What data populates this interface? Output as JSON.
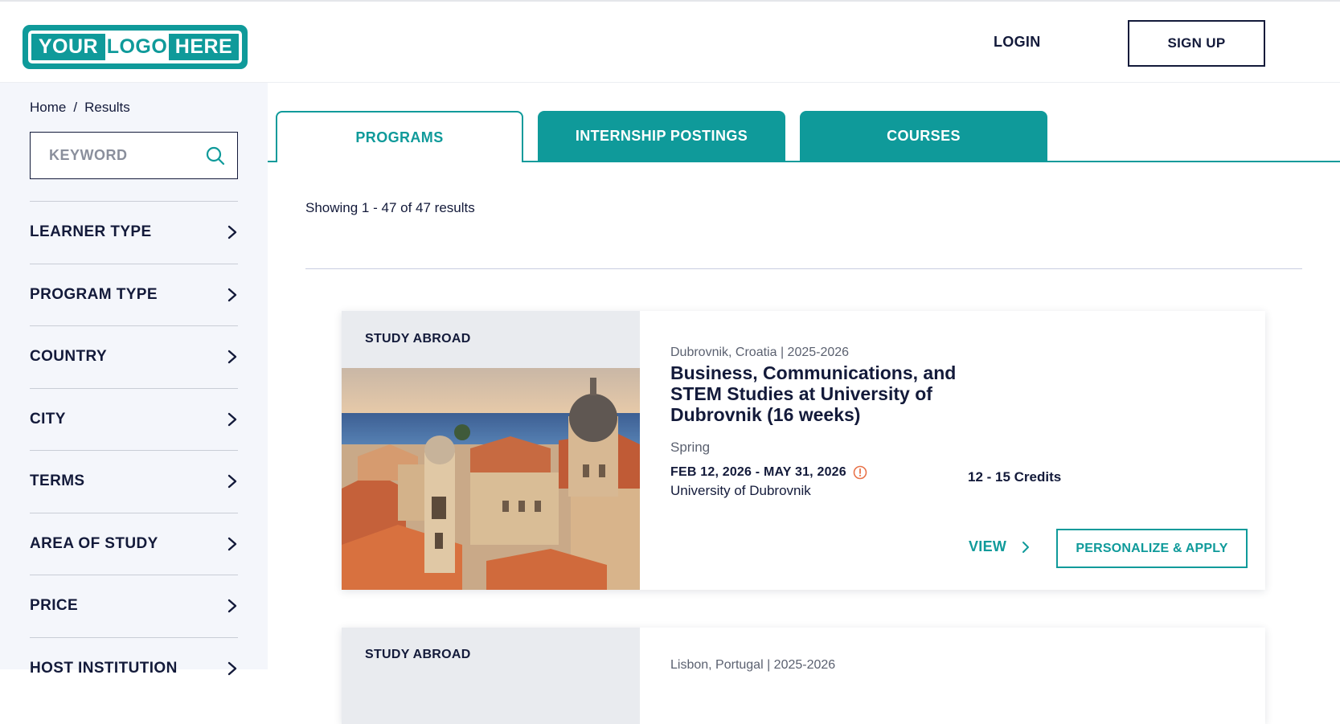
{
  "header": {
    "logo": {
      "seg1": "YOUR",
      "seg2": "LOGO",
      "seg3": "HERE"
    },
    "login_label": "LOGIN",
    "signup_label": "SIGN UP"
  },
  "sidebar": {
    "breadcrumb": {
      "home": "Home",
      "separator": "/",
      "current": "Results"
    },
    "search": {
      "placeholder": "KEYWORD",
      "value": ""
    },
    "filters": [
      {
        "label": "LEARNER TYPE"
      },
      {
        "label": "PROGRAM TYPE"
      },
      {
        "label": "COUNTRY"
      },
      {
        "label": "CITY"
      },
      {
        "label": "TERMS"
      },
      {
        "label": "AREA OF STUDY"
      },
      {
        "label": "PRICE"
      },
      {
        "label": "HOST INSTITUTION"
      }
    ]
  },
  "tabs": [
    {
      "label": "PROGRAMS",
      "active": true
    },
    {
      "label": "INTERNSHIP POSTINGS",
      "active": false
    },
    {
      "label": "COURSES",
      "active": false
    }
  ],
  "results": {
    "count_text": "Showing 1 - 47 of 47 results",
    "cards": [
      {
        "tag": "STUDY ABROAD",
        "location": "Dubrovnik, Croatia | 2025-2026",
        "title": "Business, Communications, and STEM Studies at University of Dubrovnik (16 weeks)",
        "term": "Spring",
        "dates": "FEB 12, 2026 - MAY 31, 2026",
        "institution": "University of Dubrovnik",
        "credits": "12 - 15 Credits",
        "view_label": "VIEW",
        "apply_label": "PERSONALIZE & APPLY"
      },
      {
        "tag": "STUDY ABROAD",
        "location": "Lisbon, Portugal | 2025-2026"
      }
    ]
  },
  "colors": {
    "accent": "#0f9a9a",
    "text": "#131a3a",
    "sidebar_bg": "#f4f6fb",
    "alert": "#e8734a"
  }
}
